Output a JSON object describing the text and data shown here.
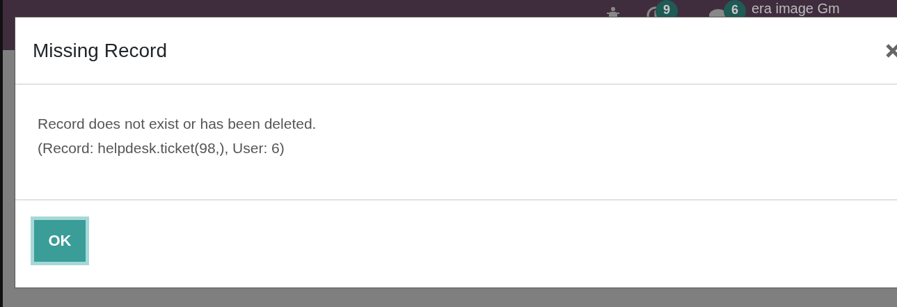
{
  "top_bar": {
    "activity_badge": "9",
    "messages_badge": "6",
    "user_name": "era image Gm"
  },
  "dialog": {
    "title": "Missing Record",
    "message": [
      "Record does not exist or has been deleted.",
      "(Record: helpdesk.ticket(98,), User: 6)"
    ],
    "button": {
      "label": "OK",
      "focused": true
    }
  }
}
